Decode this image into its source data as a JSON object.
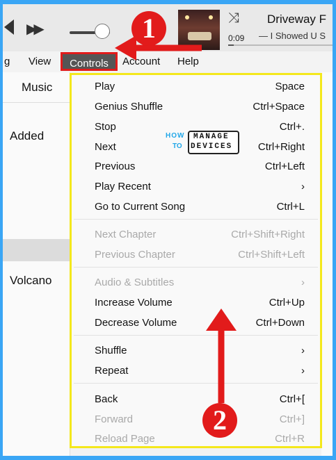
{
  "player": {
    "time": "0:09",
    "song_title": "Driveway F",
    "song_subtitle": "— I Showed U S",
    "progress_fraction": 0.05
  },
  "menubar": {
    "items": [
      "g",
      "View",
      "Controls",
      "Account",
      "Help"
    ]
  },
  "library": {
    "music_tab": "Music",
    "items": [
      "Added",
      "Volcano"
    ]
  },
  "controls_menu": {
    "items": [
      {
        "label": "Play",
        "shortcut": "Space",
        "enabled": true
      },
      {
        "label": "Genius Shuffle",
        "shortcut": "Ctrl+Space",
        "enabled": true
      },
      {
        "label": "Stop",
        "shortcut": "Ctrl+.",
        "enabled": true
      },
      {
        "label": "Next",
        "shortcut": "Ctrl+Right",
        "enabled": true
      },
      {
        "label": "Previous",
        "shortcut": "Ctrl+Left",
        "enabled": true
      },
      {
        "label": "Play Recent",
        "shortcut": "›",
        "enabled": true
      },
      {
        "label": "Go to Current Song",
        "shortcut": "Ctrl+L",
        "enabled": true
      },
      {
        "label": "Next Chapter",
        "shortcut": "Ctrl+Shift+Right",
        "enabled": false
      },
      {
        "label": "Previous Chapter",
        "shortcut": "Ctrl+Shift+Left",
        "enabled": false
      },
      {
        "label": "Audio & Subtitles",
        "shortcut": "›",
        "enabled": false
      },
      {
        "label": "Increase Volume",
        "shortcut": "Ctrl+Up",
        "enabled": true
      },
      {
        "label": "Decrease Volume",
        "shortcut": "Ctrl+Down",
        "enabled": true
      },
      {
        "label": "Shuffle",
        "shortcut": "›",
        "enabled": true
      },
      {
        "label": "Repeat",
        "shortcut": "›",
        "enabled": true
      },
      {
        "label": "Back",
        "shortcut": "Ctrl+[",
        "enabled": true
      },
      {
        "label": "Forward",
        "shortcut": "Ctrl+]",
        "enabled": false
      },
      {
        "label": "Reload Page",
        "shortcut": "Ctrl+R",
        "enabled": false
      }
    ]
  },
  "watermark": {
    "how": "HOW",
    "to": "TO",
    "manage": "MANAGE",
    "devices": "DEVICES"
  },
  "annotations": {
    "step1": "1",
    "step2": "2"
  },
  "colors": {
    "annotation_red": "#e21b1b",
    "highlight_yellow": "#f4e81c",
    "background_blue": "#3aa6f5"
  }
}
